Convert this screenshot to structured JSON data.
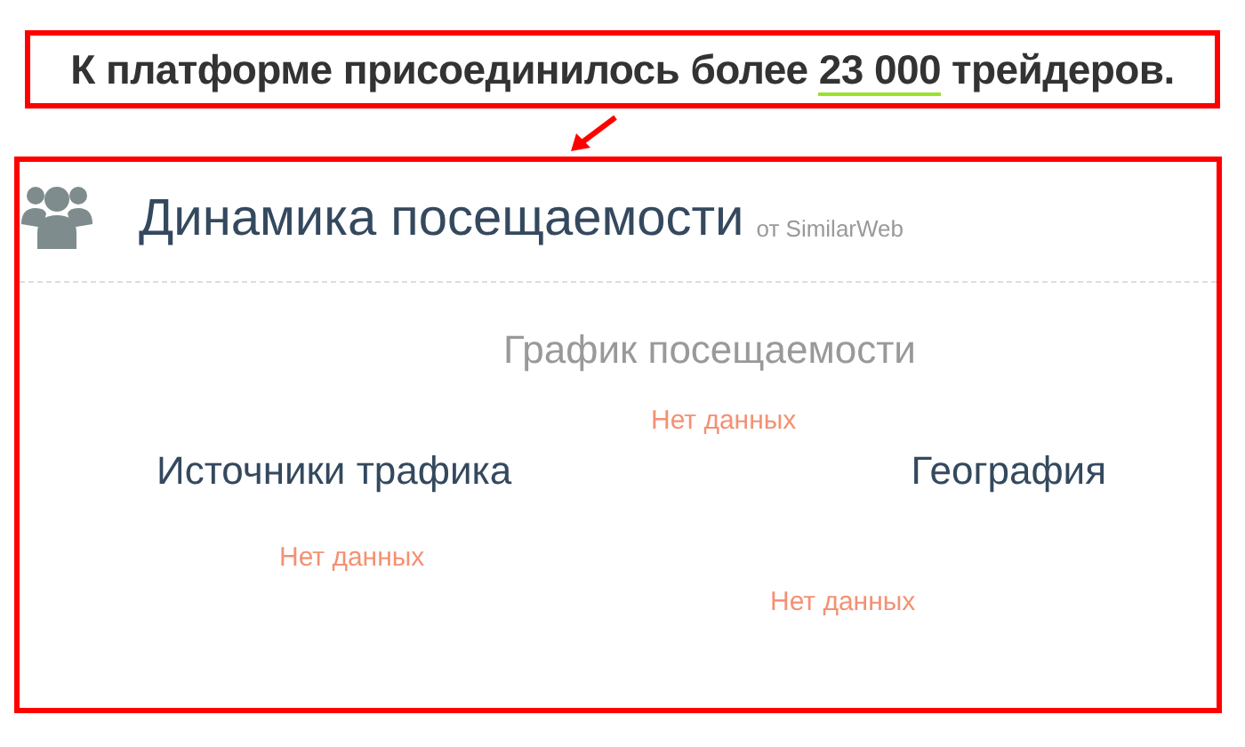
{
  "headline": {
    "before": "К платформе присоединилось более ",
    "highlight": "23 000",
    "after": " трейдеров."
  },
  "panel": {
    "title": "Динамика посещаемости",
    "source": "от SimilarWeb"
  },
  "traffic_chart": {
    "title": "График посещаемости",
    "message": "Нет данных"
  },
  "sources": {
    "title": "Источники трафика",
    "message": "Нет данных"
  },
  "geography": {
    "title": "География",
    "message": "Нет данных"
  }
}
